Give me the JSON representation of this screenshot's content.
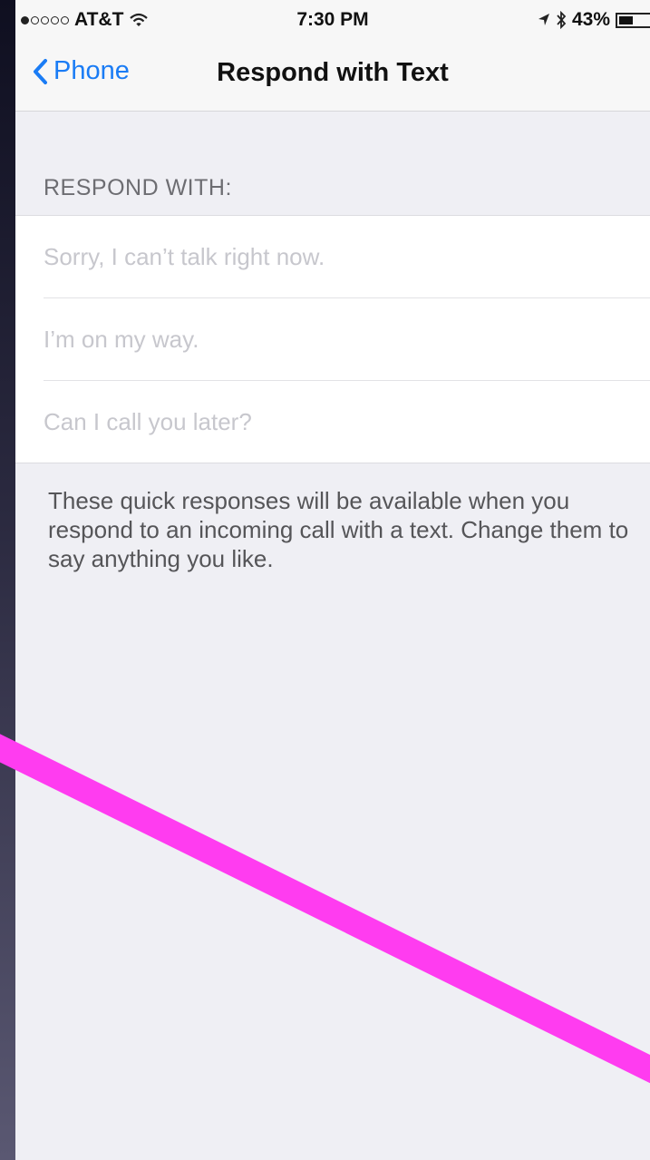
{
  "status_bar": {
    "carrier": "AT&T",
    "time": "7:30 PM",
    "battery": "43%",
    "battery_level": 0.43,
    "signal_bars": 1,
    "icons": [
      "signal-dots-icon",
      "wifi-icon",
      "location-arrow-icon",
      "bluetooth-icon",
      "battery-icon"
    ]
  },
  "nav": {
    "back_label": "Phone",
    "title": "Respond with Text",
    "back_icon": "chevron-left-icon"
  },
  "section": {
    "header": "RESPOND WITH:"
  },
  "responses": [
    {
      "value": "",
      "placeholder": "Sorry, I can’t talk right now."
    },
    {
      "value": "",
      "placeholder": "I’m on my way."
    },
    {
      "value": "",
      "placeholder": "Can I call you later?"
    }
  ],
  "footer": {
    "text": "These quick responses will be available when you respond to an incoming call with a text. Change them to say anything you like."
  },
  "colors": {
    "accent": "#1a7cf5",
    "background": "#efeff4",
    "annotation": "#ff3cf0"
  }
}
